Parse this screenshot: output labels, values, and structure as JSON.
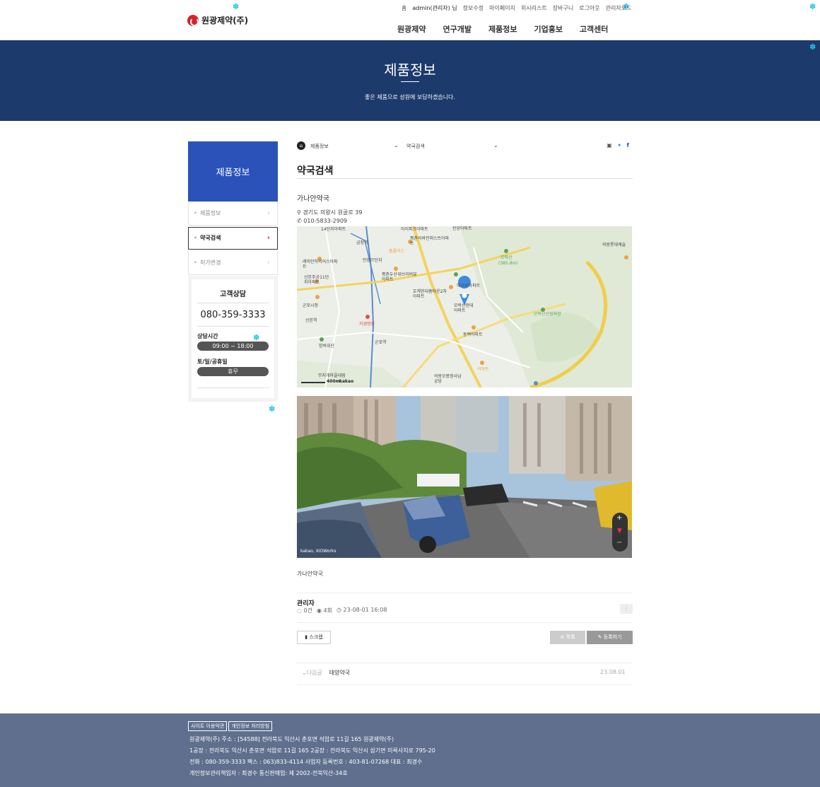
{
  "header": {
    "logo_text": "원광제약(주)",
    "util": [
      {
        "label": "홈"
      },
      {
        "label": "admin(관리자) 님"
      },
      {
        "label": "정보수정"
      },
      {
        "label": "마이페이지"
      },
      {
        "label": "위시리스트"
      },
      {
        "label": "장바구니"
      },
      {
        "label": "로그아웃"
      },
      {
        "label": "관리자모드"
      }
    ],
    "gnb": [
      {
        "label": "원광제약"
      },
      {
        "label": "연구개발"
      },
      {
        "label": "제품정보"
      },
      {
        "label": "기업홍보"
      },
      {
        "label": "고객센터"
      }
    ]
  },
  "hero": {
    "title": "제품정보",
    "subtitle": "좋은 제품으로 성원에 보답하겠습니다."
  },
  "sidebar": {
    "title": "제품정보",
    "items": [
      {
        "label": "제품정보"
      },
      {
        "label": "약국검색"
      },
      {
        "label": "허가변경"
      }
    ],
    "cs": {
      "title": "고객상담",
      "phone": "080-359-3333",
      "hours_label": "상담시간",
      "hours": "09:00 ~ 18:00",
      "holiday_label": "토/일/공휴일",
      "holiday": "휴무"
    }
  },
  "breadcrumb": {
    "level1": "제품정보",
    "level2": "약국검색"
  },
  "page_title": "약국검색",
  "post": {
    "name": "가나안약국",
    "address": "경기도 의왕시 원골로 39",
    "phone": "010-5833-2909",
    "content": "가나안약국",
    "author": "관리자",
    "comments": "0건",
    "views": "4회",
    "date": "23-08-01 16:08",
    "scrap_label": "스크랩",
    "list_label": "목록",
    "write_label": "등록하기",
    "next_label": "다음글",
    "next_title": "태양약국",
    "next_date": "23.08.01"
  },
  "map": {
    "labels": {
      "a": "14단지아파트",
      "b": "아이파크아파트",
      "c": "한양아파트",
      "d": "금정역",
      "e": "홈플러스",
      "f": "평촌어바인퍼스트아파트",
      "g": "모락산",
      "g2": "(385.8m)",
      "h": "래미안하이어스아파트",
      "i": "안양IT단지",
      "j": "평촌두산위브리버뷰아파트",
      "k": "산본주공11단지아파트",
      "l": "해모로아파트",
      "m": "호계현대홈타운2차아파트",
      "n": "모락산현대아파트",
      "o": "군포시청",
      "p": "모락산산림욕장",
      "q": "지샘병원",
      "r": "동백아파트",
      "s": "밤바위산",
      "t": "군포역",
      "u": "이마트",
      "v": "무지개마을대림",
      "w": "의왕오봉정사남궁당",
      "x": "의왕롯데캐슬",
      "y": "산본역"
    },
    "scale": "400m",
    "brand": "kakao"
  },
  "roadview": {
    "credit": "kakao, XIOWorks",
    "zoom_in": "+",
    "zoom_out": "−"
  },
  "footer": {
    "links": [
      {
        "label": "사이트 이용약관"
      },
      {
        "label": "개인정보 처리방침"
      }
    ],
    "lines": [
      "원광제약(주)    주소 : [54588] 전라북도 익산시 춘포면 석암로 11길 165 원광제약(주)",
      "1공장 : 전라북도 익산시 춘포면 석암로 11길 165    2공장 : 전라북도 익산시 삼기면 미륵사지로 795-20",
      "전화 : 080-359-3333    팩스 : 063)833-4114    사업자 등록번호 : 403-81-07268    대표 : 최경수",
      "개인정보관리책임자 : 최경수    통신판매업: 제 2002-전북익산-34호"
    ]
  },
  "colors": {
    "hero_bg": "#1c3a6b",
    "sidebar_head": "#2a52b9",
    "footer_bg": "#5f6f8d",
    "brand_red": "#d8232a",
    "gear": "#1ec3e6"
  }
}
